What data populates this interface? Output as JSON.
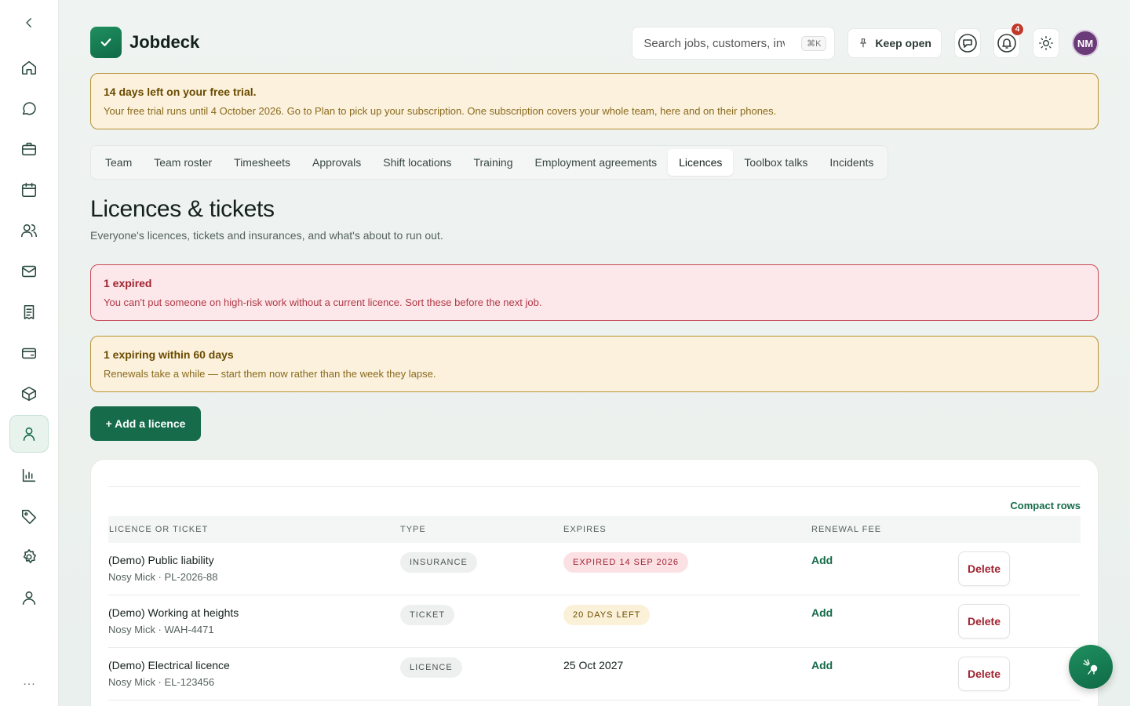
{
  "app": {
    "name": "Jobdeck"
  },
  "sidebar": {
    "collapse_icon": "chevron-left-icon",
    "items": [
      {
        "name": "home",
        "icon": "home-icon"
      },
      {
        "name": "messages",
        "icon": "chat-icon"
      },
      {
        "name": "jobs",
        "icon": "briefcase-icon"
      },
      {
        "name": "calendar",
        "icon": "calendar-icon"
      },
      {
        "name": "customers",
        "icon": "users-icon"
      },
      {
        "name": "mail",
        "icon": "mail-icon"
      },
      {
        "name": "invoices",
        "icon": "receipt-icon"
      },
      {
        "name": "payments",
        "icon": "card-icon"
      },
      {
        "name": "inventory",
        "icon": "box-icon"
      },
      {
        "name": "team",
        "icon": "person-icon",
        "active": true
      },
      {
        "name": "reports",
        "icon": "bar-chart-icon"
      },
      {
        "name": "pricing",
        "icon": "tag-icon"
      },
      {
        "name": "settings",
        "icon": "gear-icon"
      },
      {
        "name": "account",
        "icon": "user-icon"
      }
    ],
    "more_label": "..."
  },
  "header": {
    "search_placeholder": "Search jobs, customers, invoices",
    "search_shortcut": "⌘K",
    "keep_open_label": "Keep open",
    "notification_count": "4",
    "avatar_initials": "NM"
  },
  "trial_banner": {
    "title": "14 days left on your free trial.",
    "text": "Your free trial runs until 4 October 2026. Go to Plan to pick up your subscription. One subscription covers your whole team, here and on their phones."
  },
  "tabs": [
    {
      "label": "Team"
    },
    {
      "label": "Team roster"
    },
    {
      "label": "Timesheets"
    },
    {
      "label": "Approvals"
    },
    {
      "label": "Shift locations"
    },
    {
      "label": "Training"
    },
    {
      "label": "Employment agreements"
    },
    {
      "label": "Licences",
      "active": true
    },
    {
      "label": "Toolbox talks"
    },
    {
      "label": "Incidents"
    }
  ],
  "page": {
    "title": "Licences & tickets",
    "subtitle": "Everyone's licences, tickets and insurances, and what's about to run out."
  },
  "expired_banner": {
    "title": "1 expired",
    "text": "You can't put someone on high-risk work without a current licence. Sort these before the next job."
  },
  "expiring_banner": {
    "title": "1 expiring within 60 days",
    "text": "Renewals take a while — start them now rather than the week they lapse."
  },
  "add_button_label": "+ Add a licence",
  "table": {
    "compact_label": "Compact rows",
    "columns": [
      "Licence or ticket",
      "Type",
      "Expires",
      "Renewal fee"
    ],
    "rows": [
      {
        "name": "(Demo) Public liability",
        "sub": "Nosy Mick · PL-2026-88",
        "type": "INSURANCE",
        "expires": "EXPIRED 14 SEP 2026",
        "expires_style": "expired",
        "fee": "Add",
        "action": "Delete"
      },
      {
        "name": "(Demo) Working at heights",
        "sub": "Nosy Mick · WAH-4471",
        "type": "TICKET",
        "expires": "20 DAYS LEFT",
        "expires_style": "soon",
        "fee": "Add",
        "action": "Delete"
      },
      {
        "name": "(Demo) Electrical licence",
        "sub": "Nosy Mick · EL-123456",
        "type": "LICENCE",
        "expires": "25 Oct 2027",
        "expires_style": "plain",
        "fee": "Add",
        "action": "Delete"
      }
    ]
  },
  "colors": {
    "brand": "#156b4a",
    "danger": "#a02431",
    "warning": "#6b4b00"
  }
}
